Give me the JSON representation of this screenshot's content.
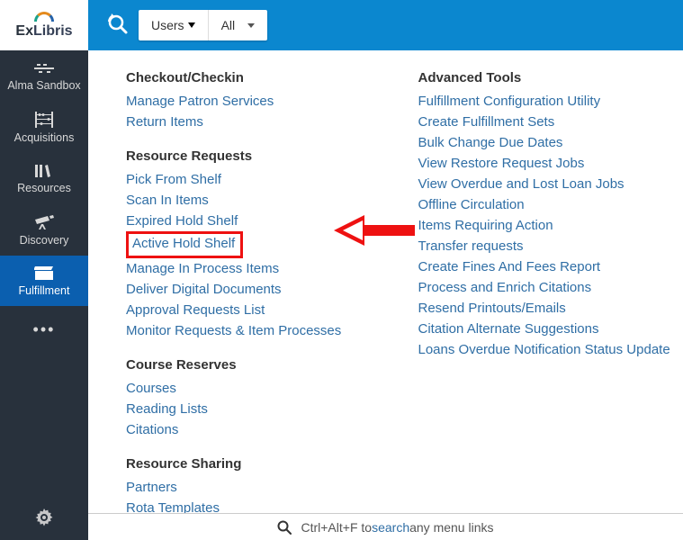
{
  "logo": {
    "brand_part1": "Ex",
    "brand_part2": "Libris"
  },
  "nav": {
    "items": [
      {
        "id": "alma-sandbox",
        "label": "Alma Sandbox"
      },
      {
        "id": "acquisitions",
        "label": "Acquisitions"
      },
      {
        "id": "resources",
        "label": "Resources"
      },
      {
        "id": "discovery",
        "label": "Discovery"
      },
      {
        "id": "fulfillment",
        "label": "Fulfillment"
      }
    ],
    "active_id": "fulfillment"
  },
  "topbar": {
    "scope_label": "Users",
    "filter_label": "All"
  },
  "menu": {
    "left_sections": [
      {
        "heading": "Checkout/Checkin",
        "links": [
          "Manage Patron Services",
          "Return Items"
        ]
      },
      {
        "heading": "Resource Requests",
        "links": [
          "Pick From Shelf",
          "Scan In Items",
          "Expired Hold Shelf",
          "Active Hold Shelf",
          "Manage In Process Items",
          "Deliver Digital Documents",
          "Approval Requests List",
          "Monitor Requests & Item Processes"
        ]
      },
      {
        "heading": "Course Reserves",
        "links": [
          "Courses",
          "Reading Lists",
          "Citations"
        ]
      },
      {
        "heading": "Resource Sharing",
        "links": [
          "Partners",
          "Rota Templates"
        ]
      }
    ],
    "right_sections": [
      {
        "heading": "Advanced Tools",
        "links": [
          "Fulfillment Configuration Utility",
          "Create Fulfillment Sets",
          "Bulk Change Due Dates",
          "View Restore Request Jobs",
          "View Overdue and Lost Loan Jobs",
          "Offline Circulation",
          "Items Requiring Action",
          "Transfer requests",
          "Create Fines And Fees Report",
          "Process and Enrich Citations",
          "Resend Printouts/Emails",
          "Citation Alternate Suggestions",
          "Loans Overdue Notification Status Update"
        ]
      }
    ],
    "highlighted_link": "Active Hold Shelf"
  },
  "bottom": {
    "pre": "Ctrl+Alt+F to ",
    "keyword": "search",
    "post": " any menu links"
  }
}
